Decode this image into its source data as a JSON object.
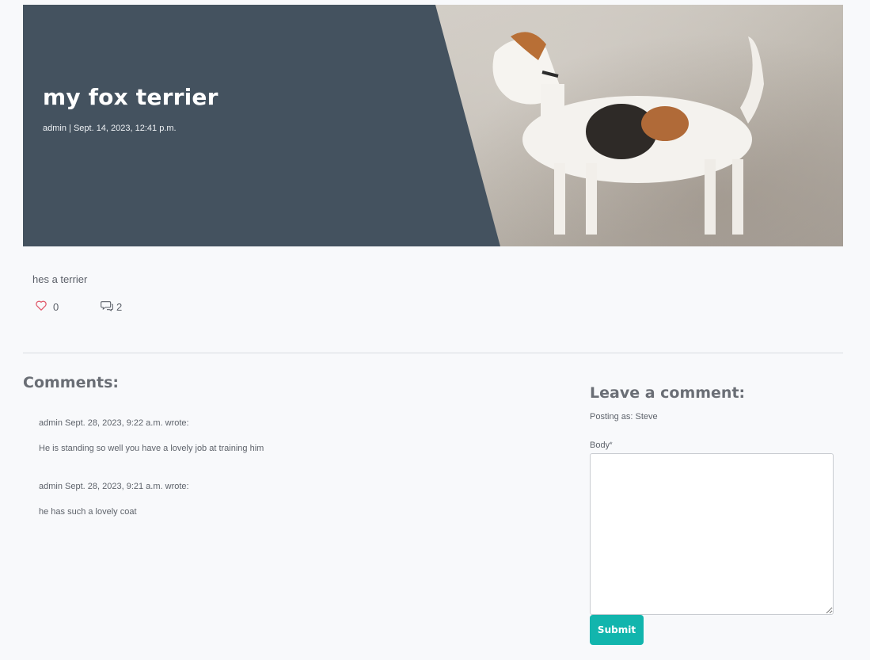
{
  "post": {
    "title": "my fox terrier",
    "author": "admin",
    "separator": "|",
    "date": "Sept. 14, 2023, 12:41 p.m.",
    "body": "hes a terrier",
    "likes": "0",
    "comment_count": "2",
    "hero_image_subject": "fox terrier standing",
    "hero_panel_color": "#44525f"
  },
  "comments_section": {
    "heading": "Comments:",
    "comments": [
      {
        "author": "admin",
        "date": "Sept. 28, 2023, 9:22 a.m.",
        "wrote": "wrote:",
        "body": "He is standing so well you have a lovely job at training him"
      },
      {
        "author": "admin",
        "date": "Sept. 28, 2023, 9:21 a.m.",
        "wrote": "wrote:",
        "body": "he has such a lovely coat"
      }
    ]
  },
  "comment_form": {
    "heading": "Leave a comment:",
    "posting_as_label": "Posting as:",
    "posting_as_user": "Steve",
    "body_label": "Body",
    "required_marker": "*",
    "body_value": "",
    "submit_label": "Submit",
    "submit_color": "#12b5ad"
  },
  "icons": {
    "like": "heart-icon",
    "comments": "comments-icon"
  }
}
